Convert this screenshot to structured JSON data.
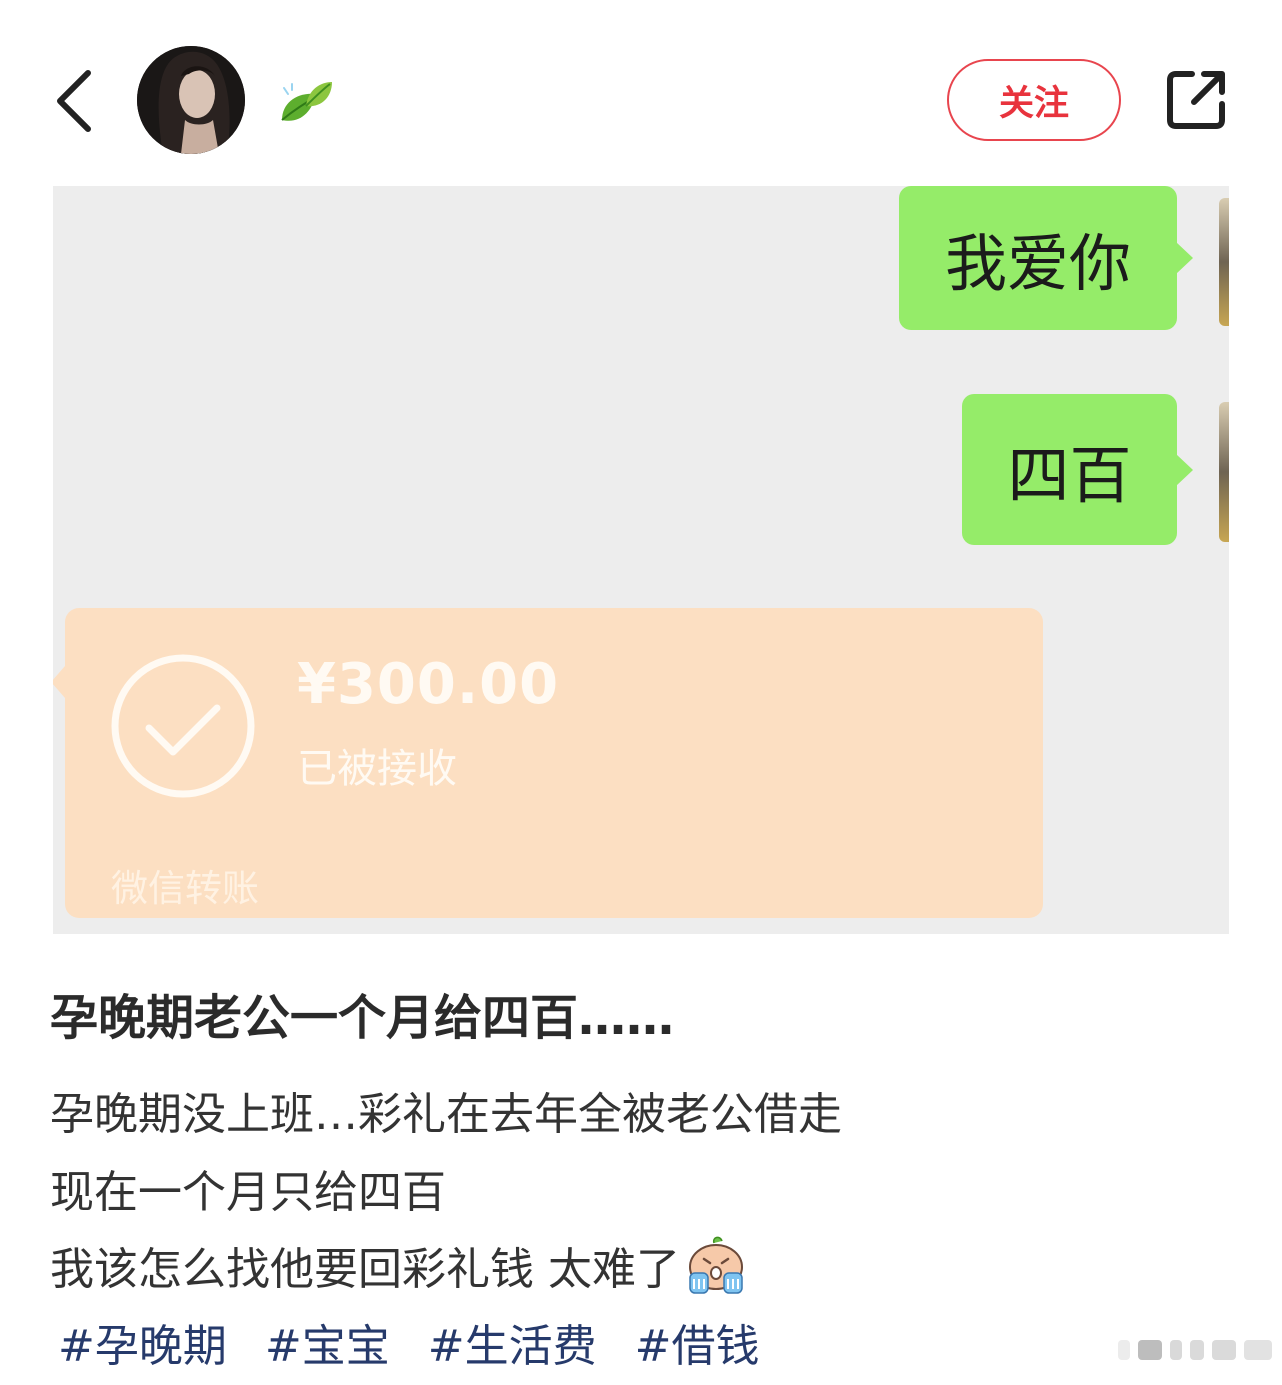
{
  "header": {
    "follow_label": "关注",
    "icons": {
      "back": "chevron-left-icon",
      "leaf": "leaf-icon",
      "share": "share-icon"
    }
  },
  "chat_screenshot": {
    "messages": [
      {
        "text": "我爱你"
      },
      {
        "text": "四百"
      }
    ],
    "transfer": {
      "amount": "¥300.00",
      "status": "已被接收",
      "footer": "微信转账"
    },
    "colors": {
      "bubble": "#95ec69",
      "transfer_card": "#fcdfc2",
      "background": "#ededed"
    }
  },
  "post": {
    "title": "孕晚期老公一个月给四百……",
    "lines": [
      "孕晚期没上班…彩礼在去年全被老公借走",
      "现在一个月只给四百",
      "我该怎么找他要回彩礼钱 太难了"
    ],
    "tags": [
      "#孕晚期",
      "#宝宝",
      "#生活费",
      "#借钱"
    ]
  },
  "colors": {
    "follow_accent": "#e8333d",
    "tag": "#263a6b"
  }
}
